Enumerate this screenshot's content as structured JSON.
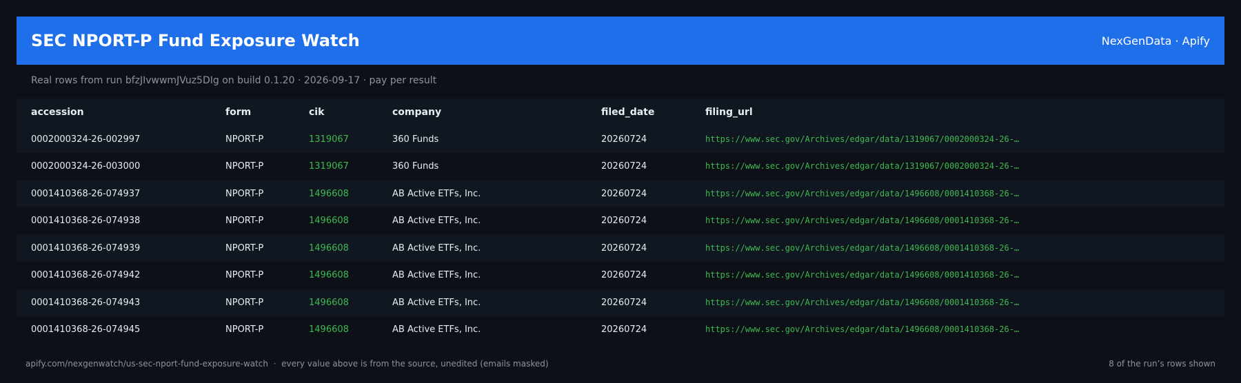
{
  "header": {
    "title": "SEC NPORT-P Fund Exposure Watch",
    "brand": "NexGenData · Apify"
  },
  "subline": "Real rows from run bfzJIvwwmJVuz5DIg on build 0.1.20 · 2026-09-17 · pay per result",
  "table": {
    "columns": [
      "accession",
      "form",
      "cik",
      "company",
      "filed_date",
      "filing_url"
    ],
    "rows": [
      [
        "0002000324-26-002997",
        "NPORT-P",
        "1319067",
        "360 Funds",
        "20260724",
        "https://www.sec.gov/Archives/edgar/data/1319067/0002000324-26-…"
      ],
      [
        "0002000324-26-003000",
        "NPORT-P",
        "1319067",
        "360 Funds",
        "20260724",
        "https://www.sec.gov/Archives/edgar/data/1319067/0002000324-26-…"
      ],
      [
        "0001410368-26-074937",
        "NPORT-P",
        "1496608",
        "AB Active ETFs, Inc.",
        "20260724",
        "https://www.sec.gov/Archives/edgar/data/1496608/0001410368-26-…"
      ],
      [
        "0001410368-26-074938",
        "NPORT-P",
        "1496608",
        "AB Active ETFs, Inc.",
        "20260724",
        "https://www.sec.gov/Archives/edgar/data/1496608/0001410368-26-…"
      ],
      [
        "0001410368-26-074939",
        "NPORT-P",
        "1496608",
        "AB Active ETFs, Inc.",
        "20260724",
        "https://www.sec.gov/Archives/edgar/data/1496608/0001410368-26-…"
      ],
      [
        "0001410368-26-074942",
        "NPORT-P",
        "1496608",
        "AB Active ETFs, Inc.",
        "20260724",
        "https://www.sec.gov/Archives/edgar/data/1496608/0001410368-26-…"
      ],
      [
        "0001410368-26-074943",
        "NPORT-P",
        "1496608",
        "AB Active ETFs, Inc.",
        "20260724",
        "https://www.sec.gov/Archives/edgar/data/1496608/0001410368-26-…"
      ],
      [
        "0001410368-26-074945",
        "NPORT-P",
        "1496608",
        "AB Active ETFs, Inc.",
        "20260724",
        "https://www.sec.gov/Archives/edgar/data/1496608/0001410368-26-…"
      ]
    ]
  },
  "footer": {
    "left": "apify.com/nexgenwatch/us-sec-nport-fund-exposure-watch  ·  every value above is from the source, unedited (emails masked)",
    "right": "8 of the run’s rows shown"
  },
  "colors": {
    "background": "#0d1117",
    "header": "#1f6feb",
    "accent_green": "#3fb950",
    "muted": "#8b949e"
  }
}
